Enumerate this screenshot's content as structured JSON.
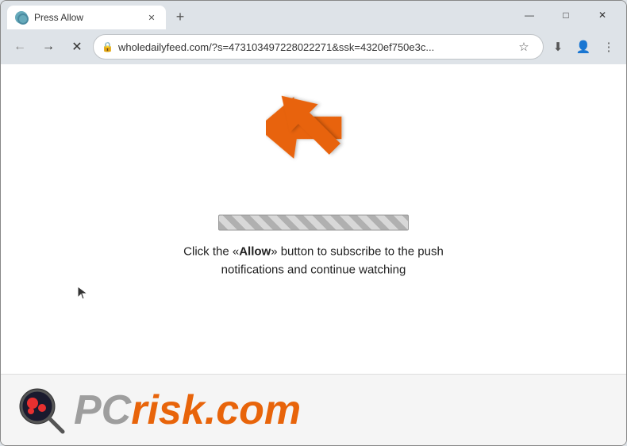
{
  "window": {
    "title": "Press Allow",
    "controls": {
      "minimize": "—",
      "maximize": "□",
      "close": "✕"
    }
  },
  "tab": {
    "title": "Press Allow",
    "close_label": "✕",
    "new_tab_label": "+"
  },
  "toolbar": {
    "back_label": "←",
    "forward_label": "→",
    "refresh_label": "✕",
    "address": "wholedailyfeed.com/?s=473103497228022271&ssk=4320ef750e3c...",
    "star_label": "☆",
    "downloads_label": "⬇",
    "profile_label": "👤",
    "menu_label": "⋮"
  },
  "page": {
    "subscribe_text_before": "Click the «",
    "subscribe_allow": "Allow",
    "subscribe_text_after": "» button to subscribe to the push notifications and continue watching"
  },
  "footer": {
    "pc_text": "PC",
    "risk_text": "risk",
    "dotcom_text": ".com"
  }
}
